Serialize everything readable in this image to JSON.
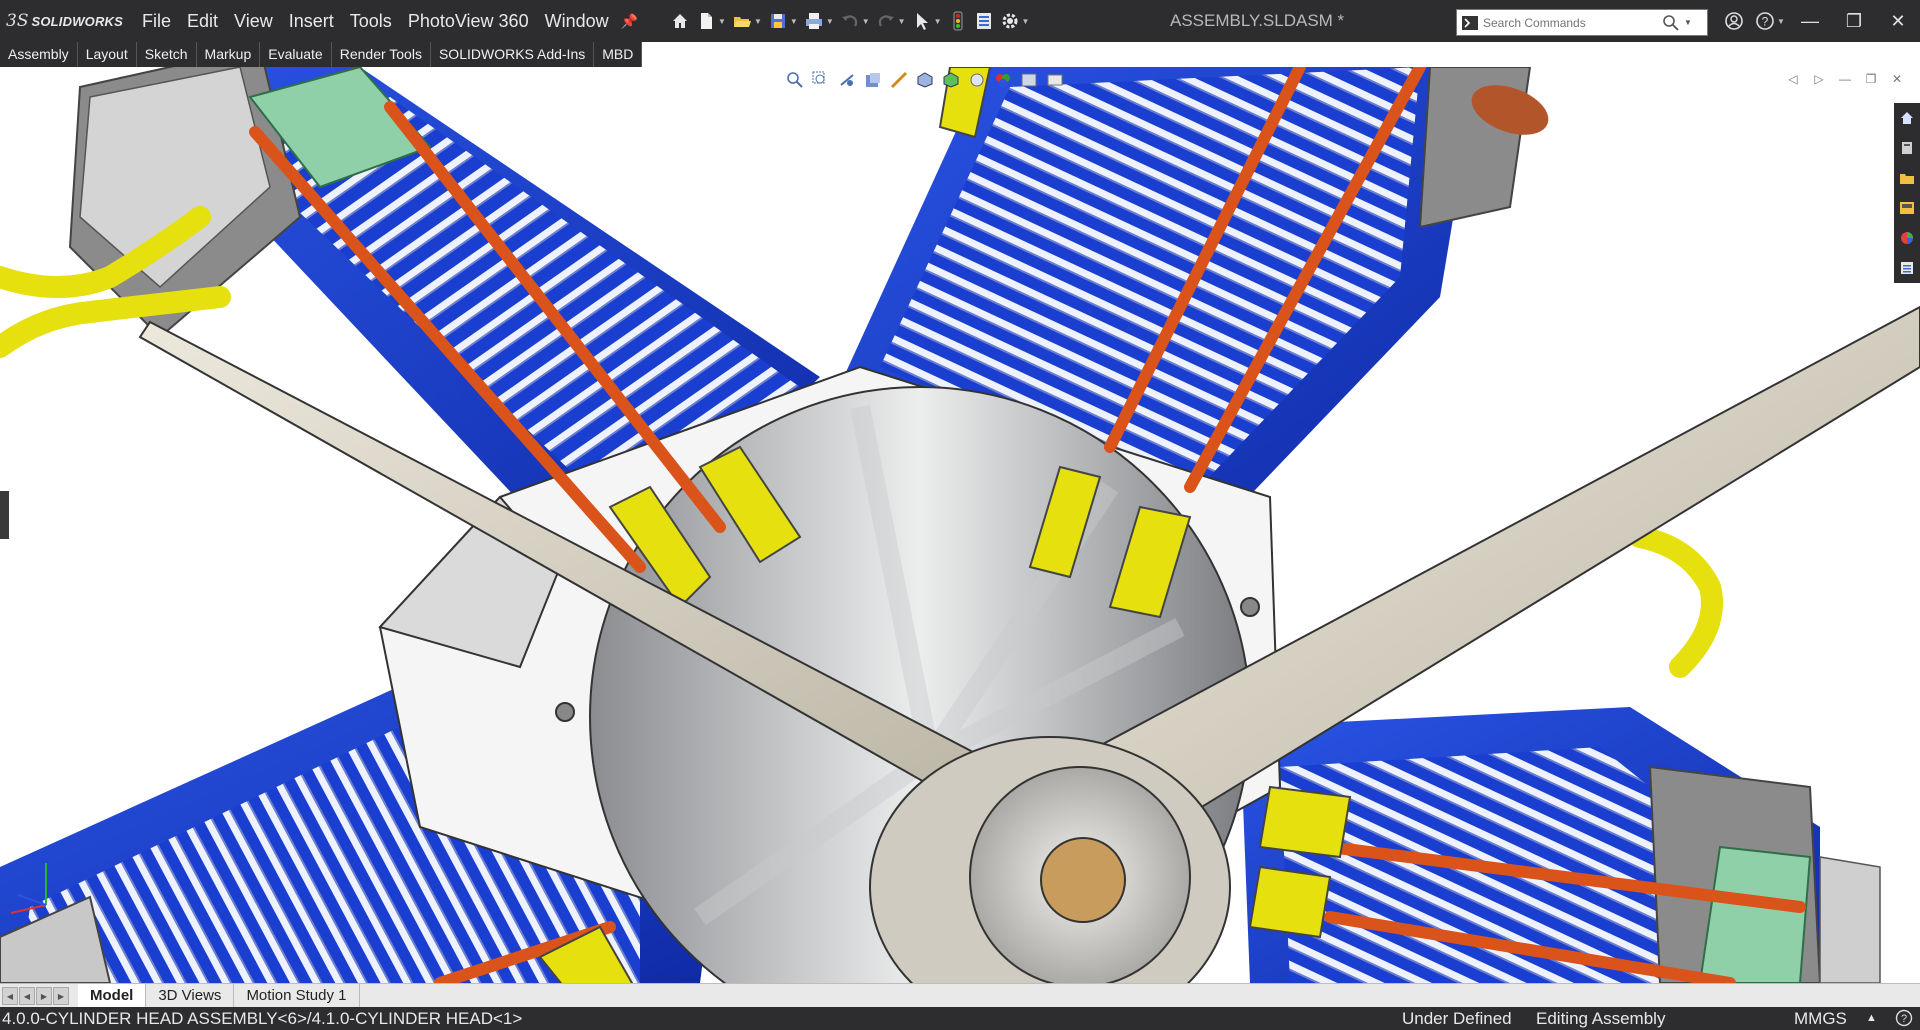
{
  "app": {
    "logo_symbol": "3S",
    "logo_text": "SOLIDWORKS",
    "document_title": "ASSEMBLY.SLDASM *"
  },
  "menu": {
    "items": [
      "File",
      "Edit",
      "View",
      "Insert",
      "Tools",
      "PhotoView 360",
      "Window"
    ]
  },
  "search": {
    "placeholder": "Search Commands"
  },
  "command_tabs": [
    "Assembly",
    "Layout",
    "Sketch",
    "Markup",
    "Evaluate",
    "Render Tools",
    "SOLIDWORKS Add-Ins",
    "MBD"
  ],
  "bottom_tabs": {
    "model": "Model",
    "views3d": "3D Views",
    "motion": "Motion Study 1",
    "active": "Model"
  },
  "status": {
    "path": "4.0.0-CYLINDER HEAD ASSEMBLY<6>/4.1.0-CYLINDER HEAD<1>",
    "definition": "Under Defined",
    "mode": "Editing Assembly",
    "units": "MMGS"
  },
  "colors": {
    "title_bar": "#2d2d30",
    "cylinder_blue": "#1638c4",
    "rod_orange": "#d9531a",
    "pushrod_yellow": "#e5e00e",
    "propeller": "#e6e2d6",
    "hub_copper": "#c89c5c"
  },
  "icons": {
    "toolbar": [
      "home-icon",
      "new-document-icon",
      "open-icon",
      "print-icon",
      "undo-icon",
      "redo-icon",
      "select-icon",
      "rebuild-icon",
      "file-properties-icon",
      "options-icon"
    ],
    "taskpane": [
      "solidworks-resources-icon",
      "design-library-icon",
      "file-explorer-icon",
      "view-palette-icon",
      "appearances-icon",
      "custom-properties-icon"
    ]
  }
}
